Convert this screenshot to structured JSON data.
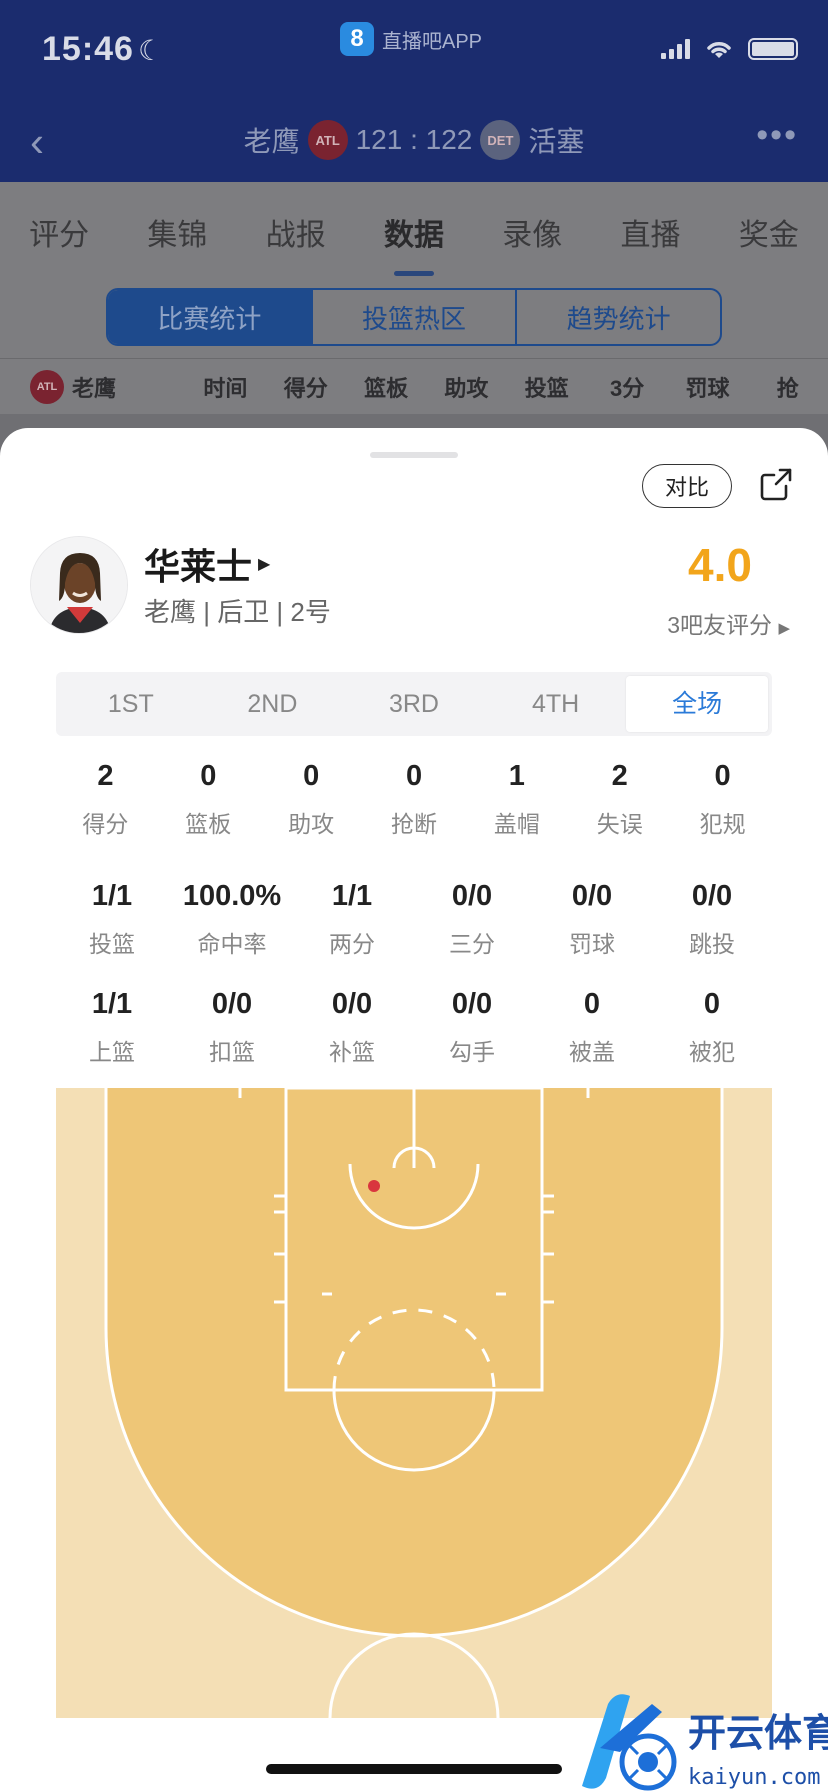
{
  "status_bar": {
    "time": "15:46",
    "app_name": "直播吧APP",
    "app_logo_text": "8"
  },
  "game": {
    "home_team": "老鹰",
    "home_badge": "ATL",
    "score": "121 : 122",
    "away_team": "活塞",
    "away_badge": "DET"
  },
  "tabs": [
    "评分",
    "集锦",
    "战报",
    "数据",
    "录像",
    "直播",
    "奖金"
  ],
  "active_tab": "数据",
  "segments": [
    "比赛统计",
    "投篮热区",
    "趋势统计"
  ],
  "stat_header": {
    "team": "老鹰",
    "columns": [
      "时间",
      "得分",
      "篮板",
      "助攻",
      "投篮",
      "3分",
      "罚球",
      "抢"
    ]
  },
  "sheet": {
    "compare_label": "对比",
    "player": {
      "name": "华莱士",
      "meta": "老鹰 | 后卫 | 2号"
    },
    "rating": {
      "value": "4.0",
      "count_label": "3吧友评分"
    },
    "quarters": [
      "1ST",
      "2ND",
      "3RD",
      "4TH",
      "全场"
    ],
    "active_quarter": "全场",
    "basic_stats": [
      {
        "value": "2",
        "label": "得分"
      },
      {
        "value": "0",
        "label": "篮板"
      },
      {
        "value": "0",
        "label": "助攻"
      },
      {
        "value": "0",
        "label": "抢断"
      },
      {
        "value": "1",
        "label": "盖帽"
      },
      {
        "value": "2",
        "label": "失误"
      },
      {
        "value": "0",
        "label": "犯规"
      }
    ],
    "shooting_stats": [
      {
        "value": "1/1",
        "label": "投篮"
      },
      {
        "value": "100.0%",
        "label": "命中率"
      },
      {
        "value": "1/1",
        "label": "两分"
      },
      {
        "value": "0/0",
        "label": "三分"
      },
      {
        "value": "0/0",
        "label": "罚球"
      },
      {
        "value": "0/0",
        "label": "跳投"
      }
    ],
    "shot_types": [
      {
        "value": "1/1",
        "label": "上篮"
      },
      {
        "value": "0/0",
        "label": "扣篮"
      },
      {
        "value": "0/0",
        "label": "补篮"
      },
      {
        "value": "0/0",
        "label": "勾手"
      },
      {
        "value": "0",
        "label": "被盖"
      },
      {
        "value": "0",
        "label": "被犯"
      }
    ],
    "shots_made": 1,
    "watermark": {
      "brand": "开云体育",
      "site": "kaiyun.com"
    }
  },
  "colors": {
    "accent": "#2a7ad8",
    "rating": "#f2a51b",
    "header": "#1b2c6e",
    "court_inner": "#eec677",
    "court_outer": "#f4dfb5",
    "shot_made": "#d9363e"
  }
}
